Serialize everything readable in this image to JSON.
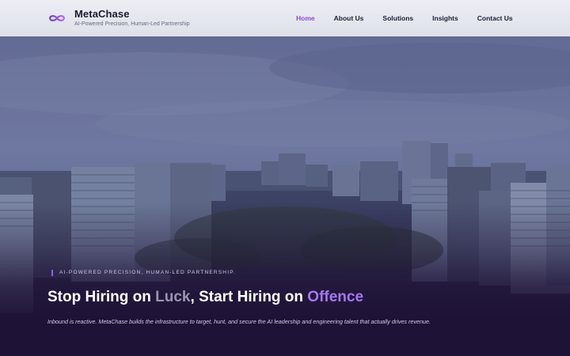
{
  "brand": {
    "name": "MetaChase",
    "tagline": "AI-Powered Precision, Human-Led Partnership",
    "logo_icon": "infinity-loop-icon",
    "accent_color": "#8a4cd8"
  },
  "nav": {
    "items": [
      {
        "label": "Home",
        "active": true
      },
      {
        "label": "About Us",
        "active": false
      },
      {
        "label": "Solutions",
        "active": false
      },
      {
        "label": "Insights",
        "active": false
      },
      {
        "label": "Contact Us",
        "active": false
      }
    ]
  },
  "hero": {
    "background": "city skyline photo at dusk",
    "eyebrow": "AI-Powered Precision, Human-Led Partnership.",
    "headline": {
      "part1": "Stop Hiring on ",
      "luck": "Luck",
      "part2": ", Start Hiring on ",
      "offence": "Offence"
    },
    "subline": "Inbound is reactive. MetaChase builds the infrastructure to target, hunt, and secure the AI leadership and engineering talent that actually drives revenue.",
    "colors": {
      "luck": "#9a94ad",
      "offence": "#a676f0",
      "background": "#1e1236"
    }
  }
}
